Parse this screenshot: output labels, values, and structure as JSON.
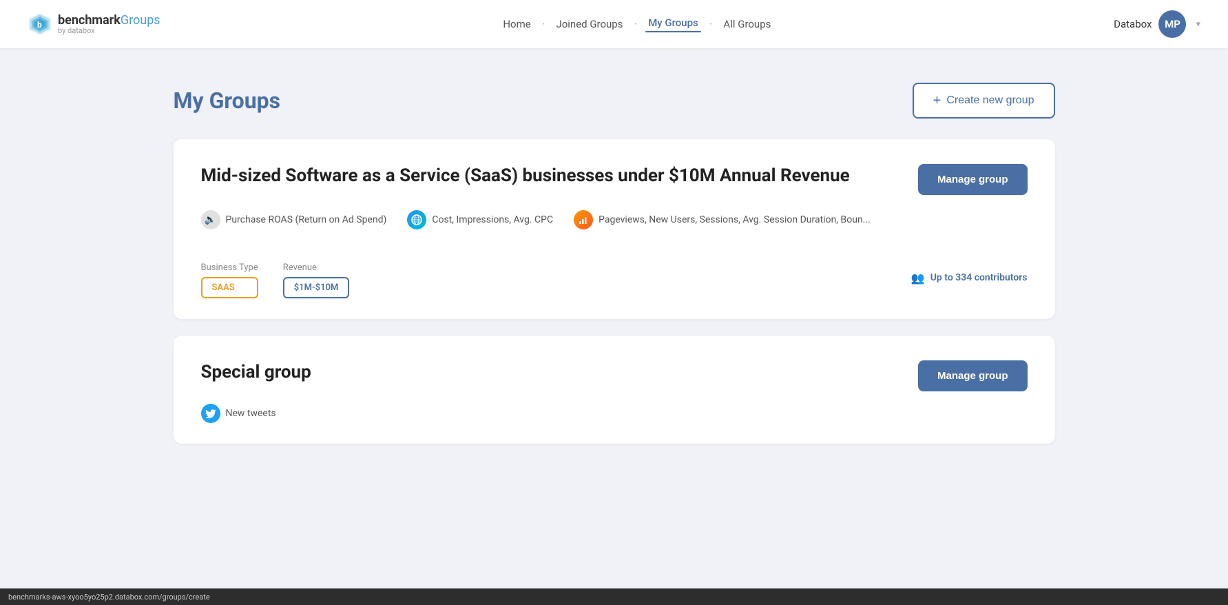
{
  "header": {
    "logo_brand": "benchmark",
    "logo_groups": "Groups",
    "logo_sub": "by databox",
    "nav": {
      "home": "Home",
      "joined_groups": "Joined Groups",
      "my_groups": "My Groups",
      "all_groups": "All Groups"
    },
    "user_name": "Databox",
    "avatar_initials": "MP",
    "chevron": "▾"
  },
  "page": {
    "title": "My Groups",
    "create_btn_label": "Create new group",
    "plus_symbol": "+"
  },
  "groups": [
    {
      "title": "Mid-sized Software as a Service (SaaS) businesses under $10M Annual Revenue",
      "manage_label": "Manage group",
      "metrics": [
        {
          "type": "gray",
          "icon": "🔈",
          "text": "Purchase ROAS (Return on Ad Spend)"
        },
        {
          "type": "blue-globe",
          "icon": "🌐",
          "text": "Cost, Impressions, Avg. CPC"
        },
        {
          "type": "orange",
          "icon": "📊",
          "text": "Pageviews, New Users, Sessions, Avg. Session Duration, Boun..."
        }
      ],
      "business_type_label": "Business Type",
      "revenue_label": "Revenue",
      "tags": [
        {
          "type": "saas",
          "text": "SAAS"
        },
        {
          "type": "revenue",
          "text": "$1M-$10M"
        }
      ],
      "contributors": "Up to 334 contributors"
    },
    {
      "title": "Special group",
      "manage_label": "Manage group",
      "metrics": [
        {
          "type": "twitter",
          "icon": "🐦",
          "text": "New tweets"
        }
      ]
    }
  ],
  "status_bar": {
    "text": "benchmarks-aws-xyoo5yo25p2.databox.com/groups/create"
  }
}
